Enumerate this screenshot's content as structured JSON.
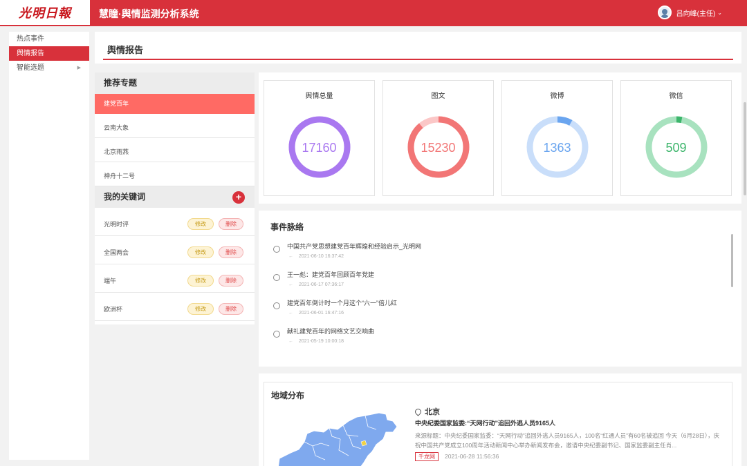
{
  "header": {
    "logo_text": "光明日報",
    "system_title": "慧瞳·舆情监测分析系统",
    "user_name": "吕向峰(主任)"
  },
  "nav": {
    "items": [
      {
        "label": "热点事件",
        "active": false
      },
      {
        "label": "舆情报告",
        "active": true
      },
      {
        "label": "智能选题",
        "active": false,
        "has_submenu": true
      }
    ]
  },
  "page": {
    "title": "舆情报告"
  },
  "topics": {
    "heading": "推荐专题",
    "items": [
      "建党百年",
      "云南大象",
      "北京雨燕",
      "神舟十二号"
    ]
  },
  "keywords": {
    "heading": "我的关键词",
    "add_icon": "plus-icon",
    "edit_label": "修改",
    "delete_label": "删除",
    "items": [
      "光明时评",
      "全国两会",
      "端午",
      "欧洲杯"
    ]
  },
  "stats": [
    {
      "label": "舆情总量",
      "value": "17160",
      "color": "#a978f0",
      "track": "#d8c6f7",
      "fraction": 1.0
    },
    {
      "label": "图文",
      "value": "15230",
      "color": "#f27676",
      "track": "#fbc7c7",
      "fraction": 0.89
    },
    {
      "label": "微博",
      "value": "1363",
      "color": "#6aa5ef",
      "track": "#c9defa",
      "fraction": 0.08
    },
    {
      "label": "微信",
      "value": "509",
      "color": "#3cb56b",
      "track": "#a8e2bf",
      "fraction": 0.03
    }
  ],
  "timeline": {
    "title": "事件脉络",
    "items": [
      {
        "text": "中国共产党思想建党百年辉煌和经验启示_光明网",
        "time": "2021-06-10 16:37:42"
      },
      {
        "text": "王一彪：建党百年回顾百年党建",
        "time": "2021-06-17 07:36:17"
      },
      {
        "text": "建党百年倒计时一个月这个“六一”倍儿红",
        "time": "2021-06-01 16:47:16"
      },
      {
        "text": "献礼建党百年的网络文艺交响曲",
        "time": "2021-05-19 10:00:18"
      }
    ]
  },
  "region": {
    "title": "地域分布",
    "location": "北京",
    "news_title": "中央纪委国家监委:“天网行动”追回外逃人员9165人",
    "news_body": "来源标题：中央纪委国家监委：“天网行动”追回外逃人员9165人，100名“红通人员”有60名被追回 今天（6月28日），庆祝中国共产党成立100周年活动新闻中心举办新闻发布会，邀请中央纪委副书记、国家监委副主任肖...",
    "source": "千龙网",
    "time": "2021-06-28 11:56:36",
    "map_fill": "#7fa9ee",
    "highlight_fill": "#f0d143"
  }
}
